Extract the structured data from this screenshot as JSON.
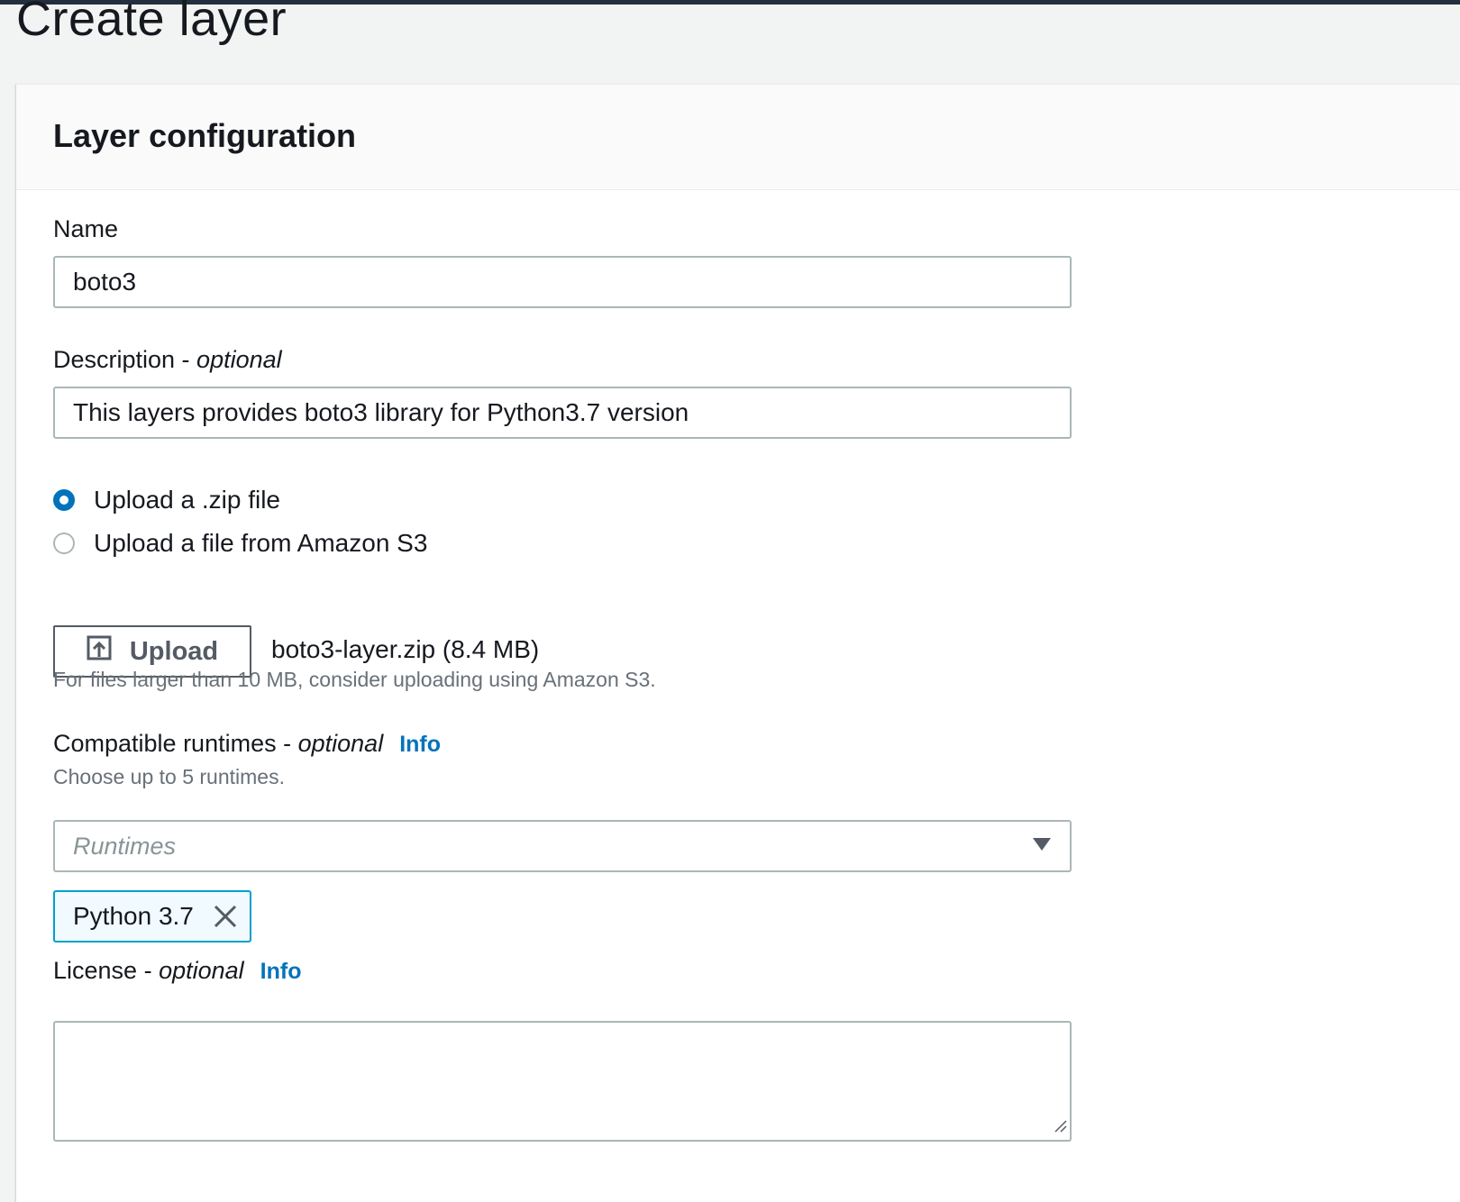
{
  "page": {
    "title": "Create layer"
  },
  "panel": {
    "title": "Layer configuration"
  },
  "name_field": {
    "label": "Name",
    "value": "boto3"
  },
  "description_field": {
    "label": "Description - ",
    "label_optional": "optional",
    "value": "This layers provides boto3 library for Python3.7 version"
  },
  "upload_options": [
    {
      "label": "Upload a .zip file",
      "selected": true
    },
    {
      "label": "Upload a file from Amazon S3",
      "selected": false
    }
  ],
  "upload": {
    "button_label": "Upload",
    "file_name": "boto3-layer.zip (8.4 MB)",
    "hint": "For files larger than 10 MB, consider uploading using Amazon S3."
  },
  "runtimes": {
    "label": "Compatible runtimes - ",
    "label_optional": "optional",
    "info": "Info",
    "hint": "Choose up to 5 runtimes.",
    "placeholder": "Runtimes",
    "selected": [
      {
        "label": "Python 3.7"
      }
    ]
  },
  "license": {
    "label": "License - ",
    "label_optional": "optional",
    "info": "Info",
    "value": ""
  },
  "colors": {
    "accent": "#0073bb",
    "token_border": "#00a1c9",
    "token_bg": "#f1faff",
    "header_bar": "#232f3e"
  },
  "icons": {
    "upload": "upload-icon",
    "dropdown": "caret-down-icon",
    "remove": "close-icon",
    "resize": "resize-grip-icon"
  }
}
